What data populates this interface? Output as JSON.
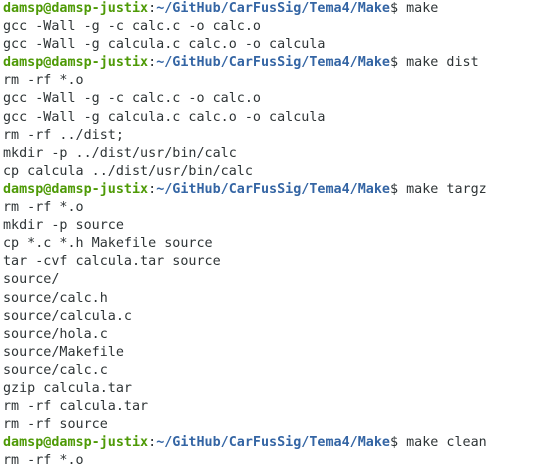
{
  "theme": {
    "background": "#ffffff",
    "text": "#2e3436",
    "user_host": "#4e9a06",
    "path": "#3465a4"
  },
  "prompt": {
    "user_host": "damsp@damsp-justix",
    "sep": ":",
    "path": "~/GitHub/CarFusSig/Tema4/Make",
    "symbol": "$ "
  },
  "blocks": [
    {
      "command": "make",
      "output": [
        "gcc -Wall -g -c calc.c -o calc.o",
        "gcc -Wall -g calcula.c calc.o -o calcula"
      ]
    },
    {
      "command": "make dist",
      "output": [
        "rm -rf *.o",
        "gcc -Wall -g -c calc.c -o calc.o",
        "gcc -Wall -g calcula.c calc.o -o calcula",
        "rm -rf ../dist;",
        "mkdir -p ../dist/usr/bin/calc",
        "cp calcula ../dist/usr/bin/calc"
      ]
    },
    {
      "command": "make targz",
      "output": [
        "rm -rf *.o",
        "mkdir -p source",
        "cp *.c *.h Makefile source",
        "tar -cvf calcula.tar source",
        "source/",
        "source/calc.h",
        "source/calcula.c",
        "source/hola.c",
        "source/Makefile",
        "source/calc.c",
        "gzip calcula.tar",
        "rm -rf calcula.tar",
        "rm -rf source"
      ]
    },
    {
      "command": "make clean",
      "output": [
        "rm -rf *.o"
      ]
    }
  ]
}
